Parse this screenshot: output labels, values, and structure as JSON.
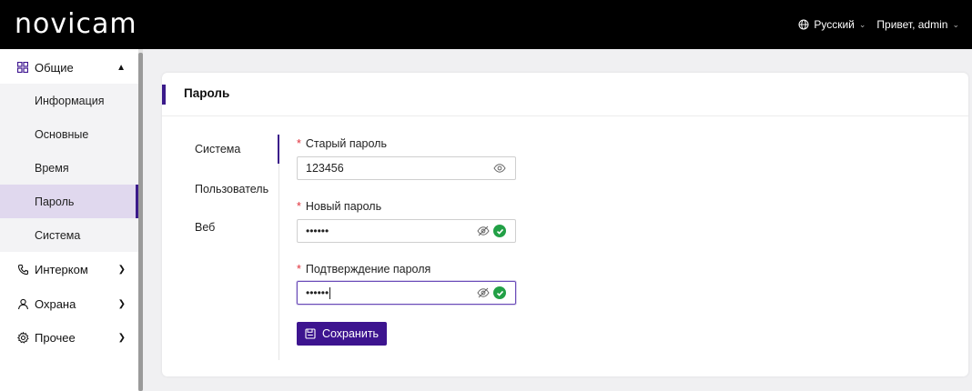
{
  "header": {
    "logo": "novicam",
    "language": "Русский",
    "greeting": "Привет, admin"
  },
  "sidebar": {
    "groups": [
      {
        "label": "Общие",
        "icon": "grid-icon",
        "expanded": true
      },
      {
        "label": "Интерком",
        "icon": "handset-icon",
        "expanded": false
      },
      {
        "label": "Охрана",
        "icon": "person-icon",
        "expanded": false
      },
      {
        "label": "Прочее",
        "icon": "gear-icon",
        "expanded": false
      }
    ],
    "general_items": [
      {
        "label": "Информация"
      },
      {
        "label": "Основные"
      },
      {
        "label": "Время"
      },
      {
        "label": "Пароль",
        "active": true
      },
      {
        "label": "Система"
      }
    ]
  },
  "panel": {
    "title": "Пароль",
    "tabs": [
      {
        "label": "Система",
        "active": true
      },
      {
        "label": "Пользователь"
      },
      {
        "label": "Веб"
      }
    ],
    "fields": {
      "old_password": {
        "label": "Старый пароль",
        "value": "123456"
      },
      "new_password": {
        "label": "Новый пароль",
        "value": "••••••"
      },
      "confirm_password": {
        "label": "Подтверждение пароля",
        "value": "••••••"
      }
    },
    "save_label": "Сохранить"
  },
  "colors": {
    "accent": "#3d148f",
    "active_bg": "#e0d8ee",
    "required": "#e0303a",
    "valid": "#22a046"
  }
}
